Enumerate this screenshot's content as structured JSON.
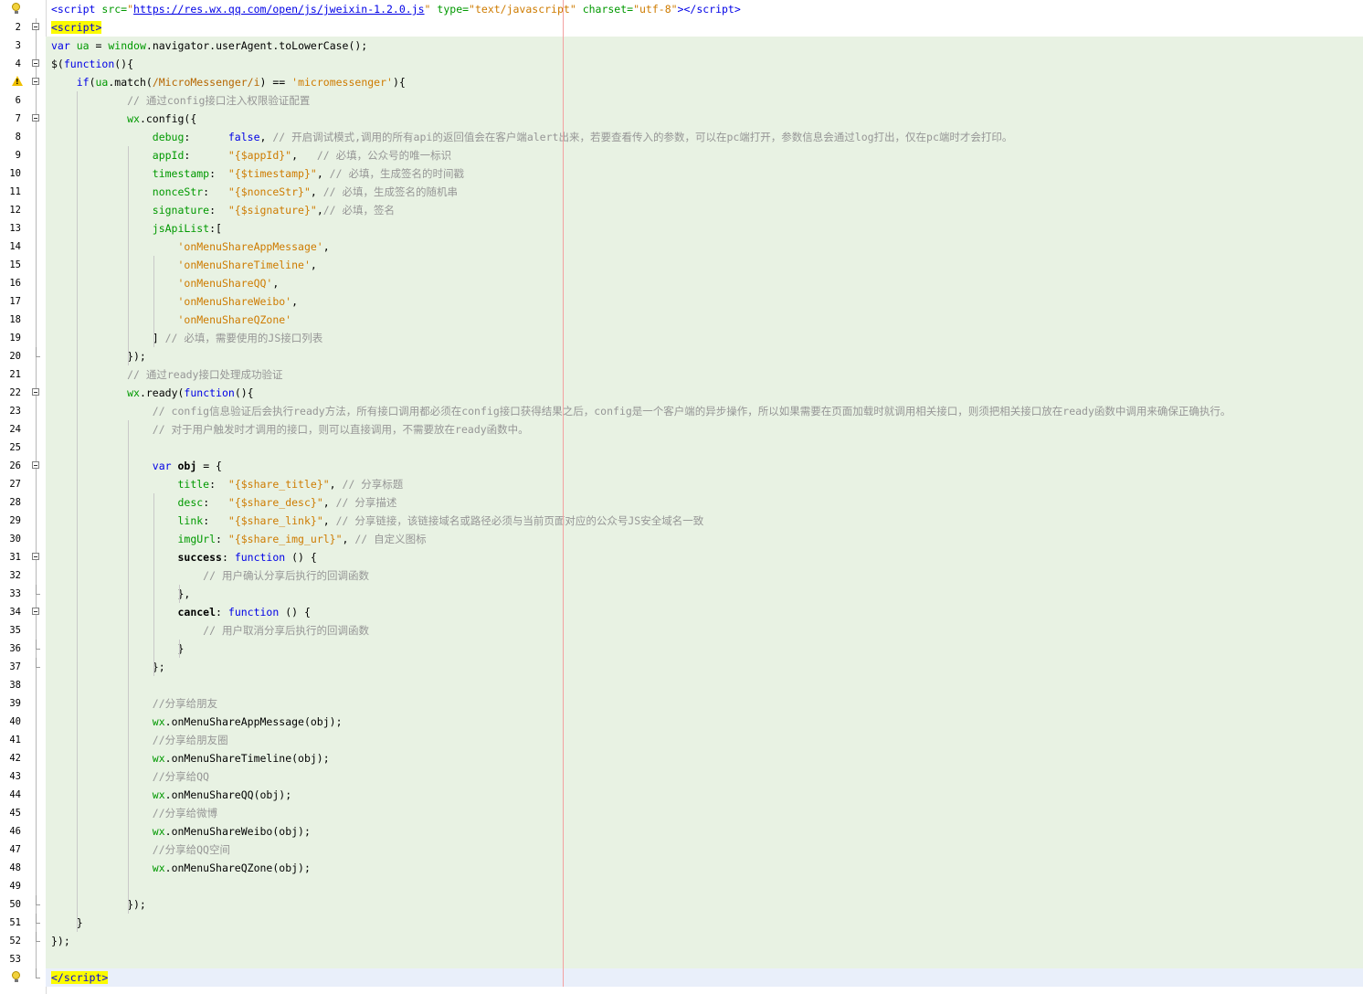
{
  "lines": [
    {
      "n": "1",
      "icon": "bulb",
      "fold": "",
      "bg": "",
      "html": "<span class=\"tag\">&lt;script</span> <span class=\"attr\">src=</span><span class=\"str\">\"<span class=\"url\">https://res.wx.qq.com/open/js/jweixin-1.2.0.js</span>\"</span> <span class=\"attr\">type=</span><span class=\"str\">\"text/javascript\"</span> <span class=\"attr\">charset=</span><span class=\"str\">\"utf-8\"</span><span class=\"tag\">&gt;&lt;/script&gt;</span>"
    },
    {
      "n": "2",
      "icon": "",
      "fold": "open",
      "bg": "",
      "html": "<span class=\"tag hl-tag\">&lt;script&gt;</span>"
    },
    {
      "n": "3",
      "icon": "",
      "fold": "",
      "bg": "green",
      "html": "<span class=\"kw\">var</span> <span class=\"prop\">ua</span> = <span class=\"prop\">window</span>.navigator.userAgent.toLowerCase();"
    },
    {
      "n": "4",
      "icon": "",
      "fold": "open",
      "bg": "green",
      "html": "$(<span class=\"kw\">function</span>(){"
    },
    {
      "n": "5",
      "icon": "warn",
      "fold": "open",
      "bg": "green",
      "html": "    <span class=\"kw\">if</span>(<span class=\"prop\">ua</span>.match(<span class=\"regex\">/MicroMessenger/i</span>) == <span class=\"str\">'micromessenger'</span>){"
    },
    {
      "n": "6",
      "icon": "",
      "fold": "",
      "bg": "green",
      "html": "            <span class=\"cm\">// 通过config接口注入权限验证配置</span>"
    },
    {
      "n": "7",
      "icon": "",
      "fold": "open",
      "bg": "green",
      "html": "            <span class=\"prop\">wx</span>.config({"
    },
    {
      "n": "8",
      "icon": "",
      "fold": "",
      "bg": "green",
      "html": "                <span class=\"prop\">debug</span>:      <span class=\"kw\">false</span>, <span class=\"cm\">// 开启调试模式,调用的所有api的返回值会在客户端alert出来，若要查看传入的参数，可以在pc端打开，参数信息会通过log打出，仅在pc端时才会打印。</span>"
    },
    {
      "n": "9",
      "icon": "",
      "fold": "",
      "bg": "green",
      "html": "                <span class=\"prop\">appId</span>:      <span class=\"str\">\"{$appId}\"</span>,   <span class=\"cm\">// 必填，公众号的唯一标识</span>"
    },
    {
      "n": "10",
      "icon": "",
      "fold": "",
      "bg": "green",
      "html": "                <span class=\"prop\">timestamp</span>:  <span class=\"str\">\"{$timestamp}\"</span>, <span class=\"cm\">// 必填，生成签名的时间戳</span>"
    },
    {
      "n": "11",
      "icon": "",
      "fold": "",
      "bg": "green",
      "html": "                <span class=\"prop\">nonceStr</span>:   <span class=\"str\">\"{$nonceStr}\"</span>, <span class=\"cm\">// 必填，生成签名的随机串</span>"
    },
    {
      "n": "12",
      "icon": "",
      "fold": "",
      "bg": "green",
      "html": "                <span class=\"prop\">signature</span>:  <span class=\"str\">\"{$signature}\"</span>,<span class=\"cm\">// 必填，签名</span>"
    },
    {
      "n": "13",
      "icon": "",
      "fold": "",
      "bg": "green",
      "html": "                <span class=\"prop\">jsApiList</span>:["
    },
    {
      "n": "14",
      "icon": "",
      "fold": "",
      "bg": "green",
      "html": "                    <span class=\"str\">'onMenuShareAppMessage'</span>,"
    },
    {
      "n": "15",
      "icon": "",
      "fold": "",
      "bg": "green",
      "html": "                    <span class=\"str\">'onMenuShareTimeline'</span>,"
    },
    {
      "n": "16",
      "icon": "",
      "fold": "",
      "bg": "green",
      "html": "                    <span class=\"str\">'onMenuShareQQ'</span>,"
    },
    {
      "n": "17",
      "icon": "",
      "fold": "",
      "bg": "green",
      "html": "                    <span class=\"str\">'onMenuShareWeibo'</span>,"
    },
    {
      "n": "18",
      "icon": "",
      "fold": "",
      "bg": "green",
      "html": "                    <span class=\"str\">'onMenuShareQZone'</span>"
    },
    {
      "n": "19",
      "icon": "",
      "fold": "",
      "bg": "green",
      "html": "                ] <span class=\"cm\">// 必填，需要使用的JS接口列表</span>"
    },
    {
      "n": "20",
      "icon": "",
      "fold": "end",
      "bg": "green",
      "html": "            });"
    },
    {
      "n": "21",
      "icon": "",
      "fold": "",
      "bg": "green",
      "html": "            <span class=\"cm\">// 通过ready接口处理成功验证</span>"
    },
    {
      "n": "22",
      "icon": "",
      "fold": "open",
      "bg": "green",
      "html": "            <span class=\"prop\">wx</span>.ready(<span class=\"kw\">function</span>(){"
    },
    {
      "n": "23",
      "icon": "",
      "fold": "",
      "bg": "green",
      "html": "                <span class=\"cm\">// config信息验证后会执行ready方法，所有接口调用都必须在config接口获得结果之后，config是一个客户端的异步操作，所以如果需要在页面加载时就调用相关接口，则须把相关接口放在ready函数中调用来确保正确执行。</span>"
    },
    {
      "n": "24",
      "icon": "",
      "fold": "",
      "bg": "green",
      "html": "                <span class=\"cm\">// 对于用户触发时才调用的接口，则可以直接调用，不需要放在ready函数中。</span>"
    },
    {
      "n": "25",
      "icon": "",
      "fold": "",
      "bg": "green",
      "html": ""
    },
    {
      "n": "26",
      "icon": "",
      "fold": "open",
      "bg": "green",
      "html": "                <span class=\"kw\">var</span> <span class=\"bold\">obj</span> = {"
    },
    {
      "n": "27",
      "icon": "",
      "fold": "",
      "bg": "green",
      "html": "                    <span class=\"prop\">title</span>:  <span class=\"str\">\"{$share_title}\"</span>, <span class=\"cm\">// 分享标题</span>"
    },
    {
      "n": "28",
      "icon": "",
      "fold": "",
      "bg": "green",
      "html": "                    <span class=\"prop\">desc</span>:   <span class=\"str\">\"{$share_desc}\"</span>, <span class=\"cm\">// 分享描述</span>"
    },
    {
      "n": "29",
      "icon": "",
      "fold": "",
      "bg": "green",
      "html": "                    <span class=\"prop\">link</span>:   <span class=\"str\">\"{$share_link}\"</span>, <span class=\"cm\">// 分享链接，该链接域名或路径必须与当前页面对应的公众号JS安全域名一致</span>"
    },
    {
      "n": "30",
      "icon": "",
      "fold": "",
      "bg": "green",
      "html": "                    <span class=\"prop\">imgUrl</span>: <span class=\"str\">\"{$share_img_url}\"</span>, <span class=\"cm\">// 自定义图标</span>"
    },
    {
      "n": "31",
      "icon": "",
      "fold": "open",
      "bg": "green",
      "html": "                    <span class=\"bold\">success</span>: <span class=\"kw\">function</span> () {"
    },
    {
      "n": "32",
      "icon": "",
      "fold": "",
      "bg": "green",
      "html": "                        <span class=\"cm\">// 用户确认分享后执行的回调函数</span>"
    },
    {
      "n": "33",
      "icon": "",
      "fold": "end",
      "bg": "green",
      "html": "                    },"
    },
    {
      "n": "34",
      "icon": "",
      "fold": "open",
      "bg": "green",
      "html": "                    <span class=\"bold\">cancel</span>: <span class=\"kw\">function</span> () {"
    },
    {
      "n": "35",
      "icon": "",
      "fold": "",
      "bg": "green",
      "html": "                        <span class=\"cm\">// 用户取消分享后执行的回调函数</span>"
    },
    {
      "n": "36",
      "icon": "",
      "fold": "end",
      "bg": "green",
      "html": "                    }"
    },
    {
      "n": "37",
      "icon": "",
      "fold": "end",
      "bg": "green",
      "html": "                };"
    },
    {
      "n": "38",
      "icon": "",
      "fold": "",
      "bg": "green",
      "html": ""
    },
    {
      "n": "39",
      "icon": "",
      "fold": "",
      "bg": "green",
      "html": "                <span class=\"cm\">//分享给朋友</span>"
    },
    {
      "n": "40",
      "icon": "",
      "fold": "",
      "bg": "green",
      "html": "                <span class=\"prop\">wx</span>.onMenuShareAppMessage(obj);"
    },
    {
      "n": "41",
      "icon": "",
      "fold": "",
      "bg": "green",
      "html": "                <span class=\"cm\">//分享给朋友圈</span>"
    },
    {
      "n": "42",
      "icon": "",
      "fold": "",
      "bg": "green",
      "html": "                <span class=\"prop\">wx</span>.onMenuShareTimeline(obj);"
    },
    {
      "n": "43",
      "icon": "",
      "fold": "",
      "bg": "green",
      "html": "                <span class=\"cm\">//分享给QQ</span>"
    },
    {
      "n": "44",
      "icon": "",
      "fold": "",
      "bg": "green",
      "html": "                <span class=\"prop\">wx</span>.onMenuShareQQ(obj);"
    },
    {
      "n": "45",
      "icon": "",
      "fold": "",
      "bg": "green",
      "html": "                <span class=\"cm\">//分享给微博</span>"
    },
    {
      "n": "46",
      "icon": "",
      "fold": "",
      "bg": "green",
      "html": "                <span class=\"prop\">wx</span>.onMenuShareWeibo(obj);"
    },
    {
      "n": "47",
      "icon": "",
      "fold": "",
      "bg": "green",
      "html": "                <span class=\"cm\">//分享给QQ空间</span>"
    },
    {
      "n": "48",
      "icon": "",
      "fold": "",
      "bg": "green",
      "html": "                <span class=\"prop\">wx</span>.onMenuShareQZone(obj);"
    },
    {
      "n": "49",
      "icon": "",
      "fold": "",
      "bg": "green",
      "html": ""
    },
    {
      "n": "50",
      "icon": "",
      "fold": "end",
      "bg": "green",
      "html": "            });"
    },
    {
      "n": "51",
      "icon": "",
      "fold": "end",
      "bg": "green",
      "html": "    }"
    },
    {
      "n": "52",
      "icon": "",
      "fold": "end",
      "bg": "green",
      "html": "});"
    },
    {
      "n": "53",
      "icon": "",
      "fold": "",
      "bg": "green",
      "html": ""
    },
    {
      "n": "54",
      "icon": "bulb",
      "fold": "end",
      "bg": "blue",
      "html": "<span class=\"tag hl-tag\">&lt;/script&gt;</span>"
    }
  ]
}
